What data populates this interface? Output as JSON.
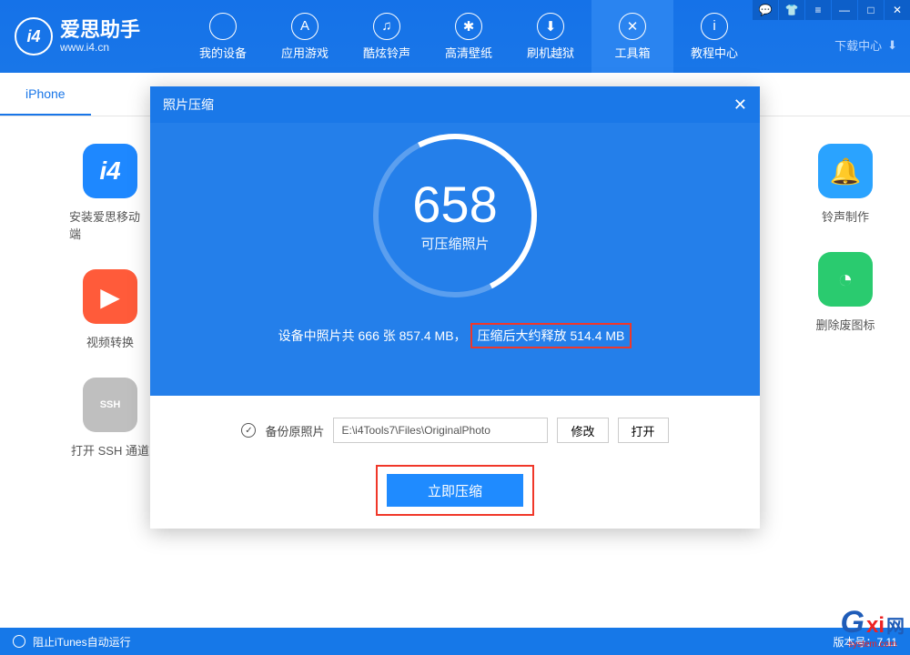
{
  "header": {
    "logo_badge": "i4",
    "logo_title": "爱思助手",
    "logo_sub": "www.i4.cn",
    "nav": [
      {
        "label": "我的设备",
        "icon": ""
      },
      {
        "label": "应用游戏",
        "icon": "A"
      },
      {
        "label": "酷炫铃声",
        "icon": "♫"
      },
      {
        "label": "高清壁纸",
        "icon": "✱"
      },
      {
        "label": "刷机越狱",
        "icon": "⬇"
      },
      {
        "label": "工具箱",
        "icon": "✕"
      },
      {
        "label": "教程中心",
        "icon": "i"
      }
    ],
    "download_center": "下载中心",
    "titlebar": {
      "chat": "💬",
      "shirt": "👕",
      "settings": "≡",
      "min": "—",
      "max": "□",
      "close": "✕"
    }
  },
  "subtabs": {
    "items": [
      "iPhone"
    ]
  },
  "tools_left": [
    {
      "label": "安装爱思移动端",
      "icon": "i4",
      "cls": "tool-i4"
    },
    {
      "label": "视频转换",
      "icon": "▶",
      "cls": "tool-video"
    },
    {
      "label": "打开 SSH 通道",
      "icon": "SSH",
      "cls": "tool-ssh"
    }
  ],
  "tools_right": [
    {
      "label": "铃声制作",
      "icon": "🔔",
      "cls": "tool-bell"
    },
    {
      "label": "删除废图标",
      "icon": "◔",
      "cls": "tool-clean"
    }
  ],
  "modal": {
    "title": "照片压缩",
    "big_number": "658",
    "circle_label": "可压缩照片",
    "summary_prefix": "设备中照片共 666 张 857.4 MB，",
    "summary_highlight": "压缩后大约释放 514.4 MB",
    "backup_label": "备份原照片",
    "path": "E:\\i4Tools7\\Files\\OriginalPhoto",
    "modify_btn": "修改",
    "open_btn": "打开",
    "compress_btn": "立即压缩"
  },
  "statusbar": {
    "left": "阻止iTunes自动运行",
    "right": "版本号：7.11"
  },
  "watermark": {
    "g": "G",
    "xi": "xi",
    "net": "网",
    "sub": "system.com"
  }
}
